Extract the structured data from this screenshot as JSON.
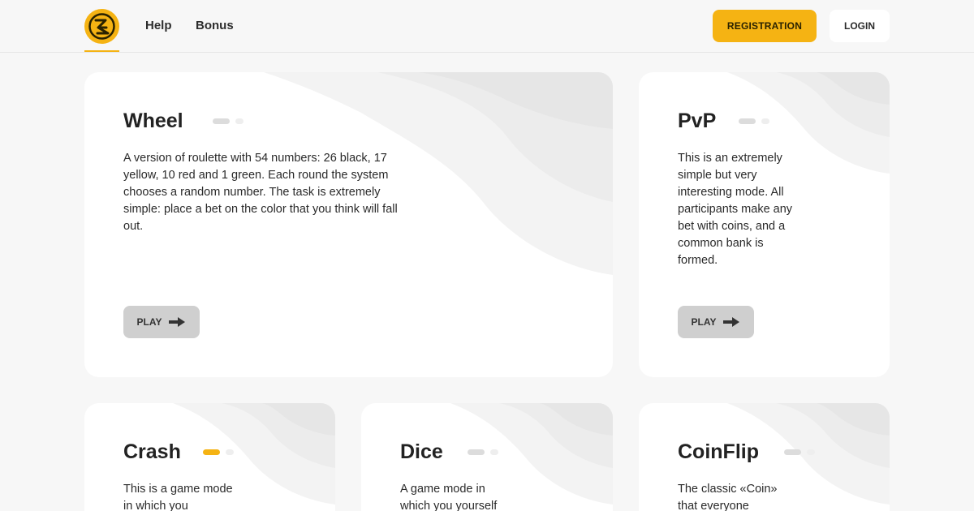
{
  "header": {
    "logo_icon": "ez-logo-icon",
    "nav": [
      {
        "label": "Help"
      },
      {
        "label": "Bonus"
      }
    ],
    "registration_label": "REGISTRATION",
    "login_label": "LOGIN"
  },
  "colors": {
    "accent": "#f5b313",
    "background": "#f7f7f7",
    "card": "#ffffff",
    "play_button": "#cfcfcf"
  },
  "cards": [
    {
      "title": "Wheel",
      "description": "A version of roulette with 54 numbers: 26 black, 17 yellow, 10 red and 1 green. Each round the system chooses a random number. The task is extremely simple: place a bet on the color that you think will fall out.",
      "play_label": "PLAY",
      "active_indicator": false
    },
    {
      "title": "PvP",
      "description": "This is an extremely simple but very interesting mode. All participants make any bet with coins, and a common bank is formed.",
      "play_label": "PLAY",
      "active_indicator": false
    },
    {
      "title": "Crash",
      "description": "This is a game mode in which you",
      "active_indicator": true
    },
    {
      "title": "Dice",
      "description": "A game mode in which you yourself",
      "active_indicator": false
    },
    {
      "title": "CoinFlip",
      "description": "The classic «Coin» that everyone",
      "active_indicator": false
    }
  ]
}
